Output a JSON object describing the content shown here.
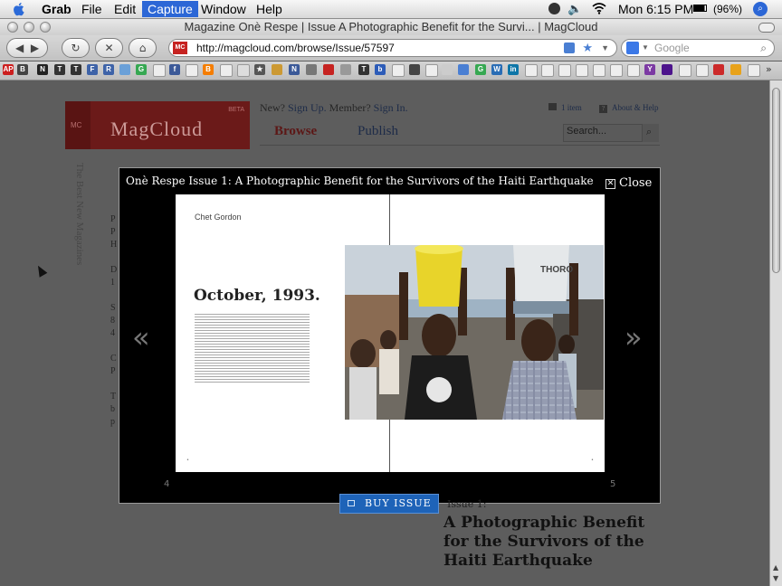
{
  "menubar": {
    "app": "Grab",
    "items": [
      "File",
      "Edit",
      "Capture",
      "Window",
      "Help"
    ],
    "active": "Capture",
    "battery": "(96%)",
    "clock": "Mon 6:15 PM"
  },
  "window": {
    "title": "Magazine Onè Respe | Issue A Photographic Benefit for the Survi... | MagCloud"
  },
  "browser": {
    "url": "http://magcloud.com/browse/Issue/57597",
    "search_placeholder": "Google"
  },
  "site": {
    "logo_text": "MagCloud",
    "logo_badge": "MC",
    "beta": "BETA",
    "signup_prefix": "New?",
    "signup": "Sign Up.",
    "signin_prefix": "Member?",
    "signin": "Sign In.",
    "cart": "1 item",
    "help": "About & Help",
    "nav_browse": "Browse",
    "nav_publish": "Publish",
    "search_placeholder": "Search...",
    "sidebar_vertical": "The Best New Magazines"
  },
  "modal": {
    "title": "Onè Respe Issue 1: A Photographic Benefit for the Survivors of the Haiti Earthquake",
    "close": "Close",
    "author": "Chet Gordon",
    "heading": "October, 1993.",
    "page_left": "4",
    "page_right": "5",
    "prev": "«",
    "next": "»",
    "photo_bucket_label": "THORO"
  },
  "buy_button": "BUY ISSUE",
  "issue_headline": [
    "A Photographic Benefit",
    "for the Survivors of the",
    "Haiti Earthquake"
  ],
  "issue_overline": "Issue 1:"
}
